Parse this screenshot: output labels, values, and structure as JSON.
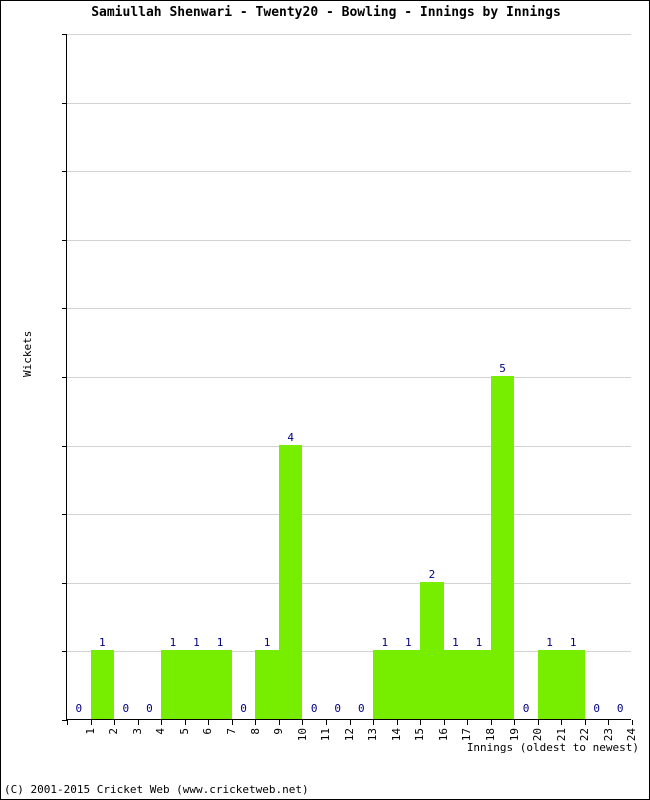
{
  "chart_data": {
    "type": "bar",
    "title": "Samiullah Shenwari - Twenty20 - Bowling - Innings by Innings",
    "xlabel": "Innings (oldest to newest)",
    "ylabel": "Wickets",
    "categories": [
      "1",
      "2",
      "3",
      "4",
      "5",
      "6",
      "7",
      "8",
      "9",
      "10",
      "11",
      "12",
      "13",
      "14",
      "15",
      "16",
      "17",
      "18",
      "19",
      "20",
      "21",
      "22",
      "23",
      "24"
    ],
    "values": [
      0,
      1,
      0,
      0,
      1,
      1,
      1,
      0,
      1,
      4,
      0,
      0,
      0,
      1,
      1,
      2,
      1,
      1,
      5,
      0,
      1,
      1,
      0,
      0
    ],
    "ylim": [
      0,
      10
    ],
    "yticks": [
      "0",
      "1",
      "2",
      "3",
      "4",
      "5",
      "6",
      "7",
      "8",
      "9",
      "10"
    ],
    "grid": true,
    "legend": false,
    "bar_color": "#77ee00",
    "label_color": "#000080"
  },
  "footer": {
    "copyright": "(C) 2001-2015 Cricket Web (www.cricketweb.net)"
  }
}
